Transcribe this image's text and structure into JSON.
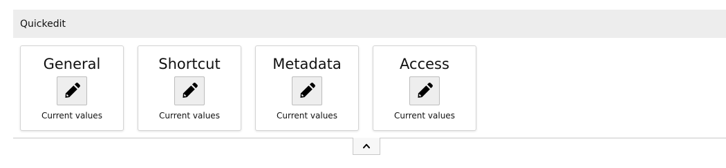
{
  "panel": {
    "title": "Quickedit"
  },
  "cards": [
    {
      "title": "General",
      "button_icon": "pencil-icon",
      "caption": "Current values"
    },
    {
      "title": "Shortcut",
      "button_icon": "pencil-icon",
      "caption": "Current values"
    },
    {
      "title": "Metadata",
      "button_icon": "pencil-icon",
      "caption": "Current values"
    },
    {
      "title": "Access",
      "button_icon": "pencil-icon",
      "caption": "Current values"
    }
  ],
  "collapse": {
    "icon": "chevron-up-icon"
  },
  "colors": {
    "header_bg": "#ededed",
    "button_bg": "#eeeeee",
    "border": "#d4d4d4"
  }
}
